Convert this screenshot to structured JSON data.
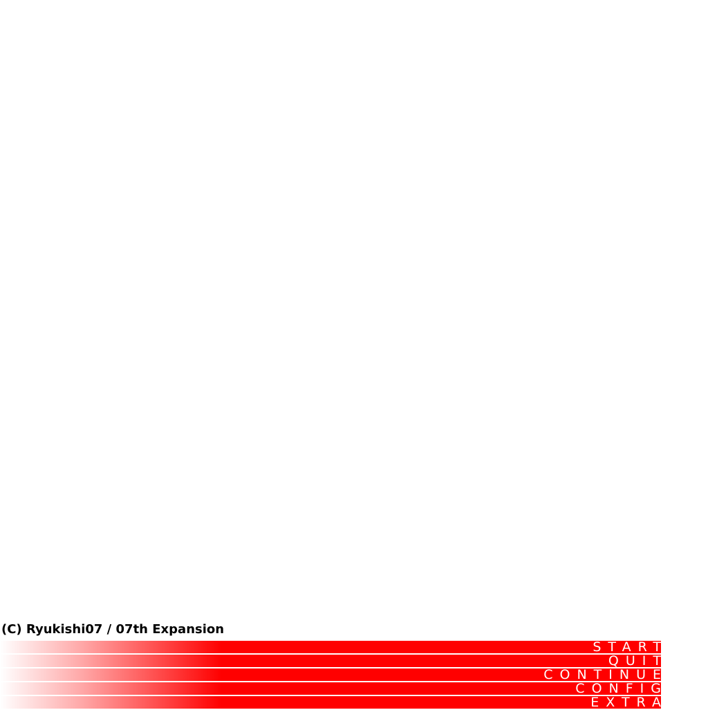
{
  "copyright": "(C) Ryukishi07 / 07th Expansion",
  "menu": {
    "items": [
      {
        "label": "START"
      },
      {
        "label": "QUIT"
      },
      {
        "label": "CONTINUE"
      },
      {
        "label": "CONFIG"
      },
      {
        "label": "EXTRA"
      }
    ]
  },
  "colors": {
    "menu_bar": "#ff0000",
    "menu_text": "#ffffff",
    "background": "#ffffff",
    "copyright_text": "#000000"
  }
}
